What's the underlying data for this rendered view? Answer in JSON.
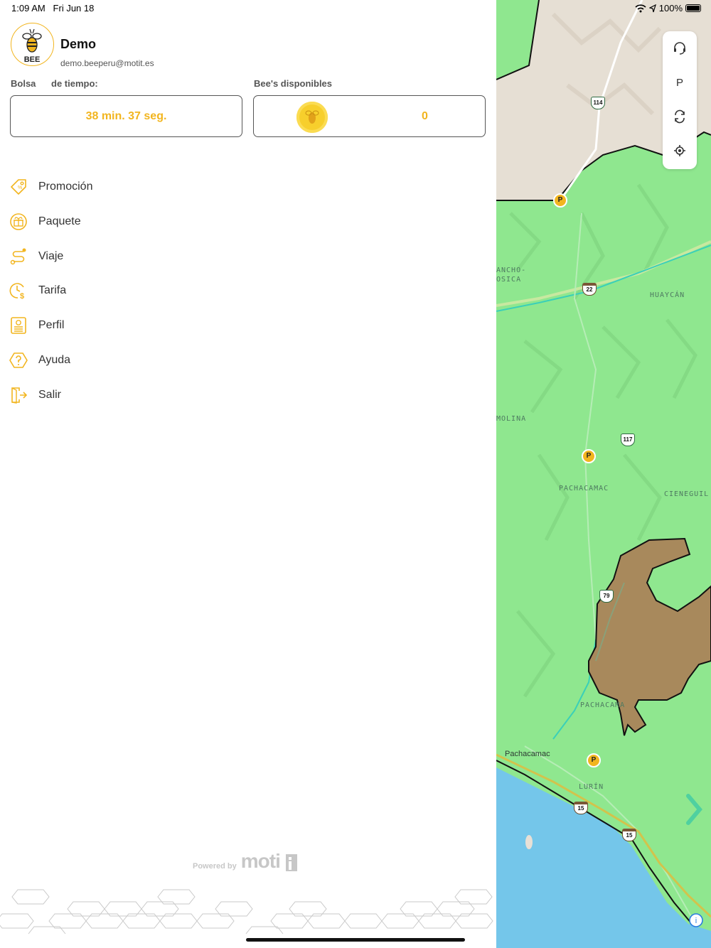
{
  "status_bar": {
    "time": "1:09 AM",
    "date": "Fri Jun 18",
    "battery": "100%"
  },
  "user": {
    "logo_text": "BEE",
    "name": "Demo",
    "email": "demo.beeperu@motit.es"
  },
  "balances": {
    "time_label_part1": "Bolsa",
    "time_label_part2": "de tiempo:",
    "time_value": "38 min. 37 seg.",
    "bees_label": "Bee's disponibles",
    "bees_value": "0"
  },
  "menu": [
    {
      "label": "Promoción",
      "icon": "tag-icon"
    },
    {
      "label": "Paquete",
      "icon": "gift-icon"
    },
    {
      "label": "Viaje",
      "icon": "route-icon"
    },
    {
      "label": "Tarifa",
      "icon": "clock-dollar-icon"
    },
    {
      "label": "Perfil",
      "icon": "profile-card-icon"
    },
    {
      "label": "Ayuda",
      "icon": "help-icon"
    },
    {
      "label": "Salir",
      "icon": "exit-icon"
    }
  ],
  "footer": {
    "powered_by": "Powered by",
    "brand": "moti"
  },
  "map": {
    "labels": [
      "ANCHO-",
      "OSICA",
      "HUAYCÁN",
      "MOLINA",
      "PACHACAMAC",
      "CIENEGUIL",
      "PACHACAMA",
      "Pachacamac",
      "LURÍN"
    ],
    "highways": [
      "114",
      "22",
      "117",
      "79",
      "15",
      "15"
    ],
    "parking_marker": "P",
    "controls": [
      {
        "name": "support",
        "icon": "headset-icon"
      },
      {
        "name": "parking",
        "label": "P"
      },
      {
        "name": "refresh",
        "icon": "refresh-icon"
      },
      {
        "name": "locate",
        "icon": "locate-icon"
      }
    ],
    "colors": {
      "zone_green": "#8fe78f",
      "restricted_zone": "#a8895c",
      "water": "#74c6ea",
      "terrain": "#e8e0d6",
      "accent_yellow": "#f2b51f"
    }
  }
}
